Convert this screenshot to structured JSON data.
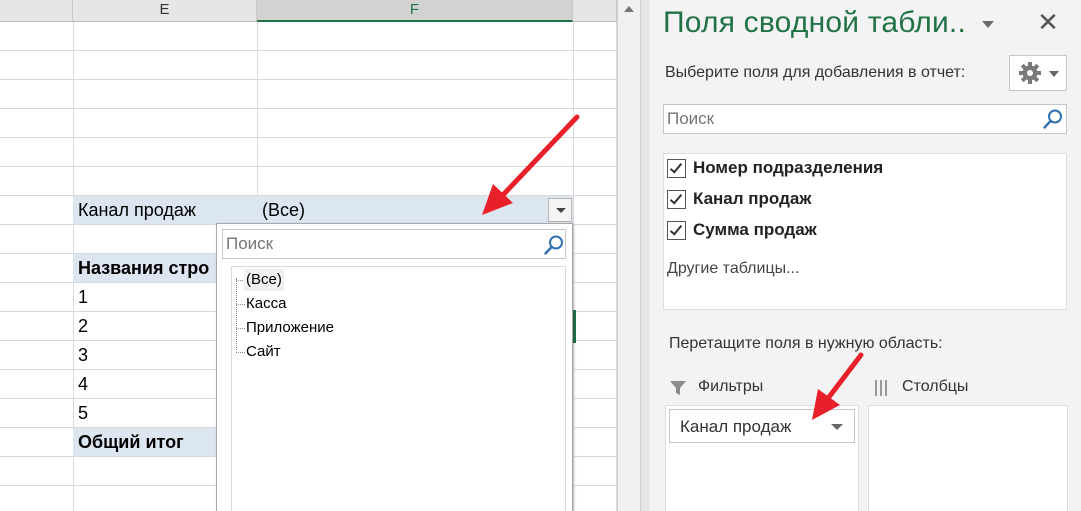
{
  "sheet": {
    "columns": [
      {
        "letter": "E",
        "selected": false
      },
      {
        "letter": "F",
        "selected": true
      }
    ],
    "page_filter": {
      "field_label": "Канал продаж",
      "value": "(Все)"
    },
    "row_header_label": "Названия стро",
    "row_values": [
      "1",
      "2",
      "3",
      "4",
      "5"
    ],
    "grand_total_label": "Общий итог"
  },
  "filter_popup": {
    "search_placeholder": "Поиск",
    "items": [
      "(Все)",
      "Касса",
      "Приложение",
      "Сайт"
    ],
    "selected_index": 0
  },
  "pivot_pane": {
    "title": "Поля сводной табли..",
    "subtitle": "Выберите поля для добавления в отчет:",
    "search_placeholder": "Поиск",
    "fields": [
      {
        "label": "Номер подразделения",
        "checked": true
      },
      {
        "label": "Канал продаж",
        "checked": true
      },
      {
        "label": "Сумма продаж",
        "checked": true
      }
    ],
    "other_tables_label": "Другие таблицы...",
    "drag_instruction": "Перетащите поля в нужную область:",
    "areas": {
      "filters": {
        "label": "Фильтры",
        "items": [
          "Канал продаж"
        ]
      },
      "columns": {
        "label": "Столбцы",
        "items": []
      }
    }
  },
  "colors": {
    "accent_green": "#217346",
    "pivot_header_fill": "#dce6f1",
    "arrow_red": "#e8202a"
  },
  "icons": {
    "search": "magnifier-icon",
    "gear": "gear-icon",
    "close": "close-icon",
    "filter": "funnel-icon",
    "columns": "columns-icon",
    "dropdown": "triangle-down-icon"
  }
}
